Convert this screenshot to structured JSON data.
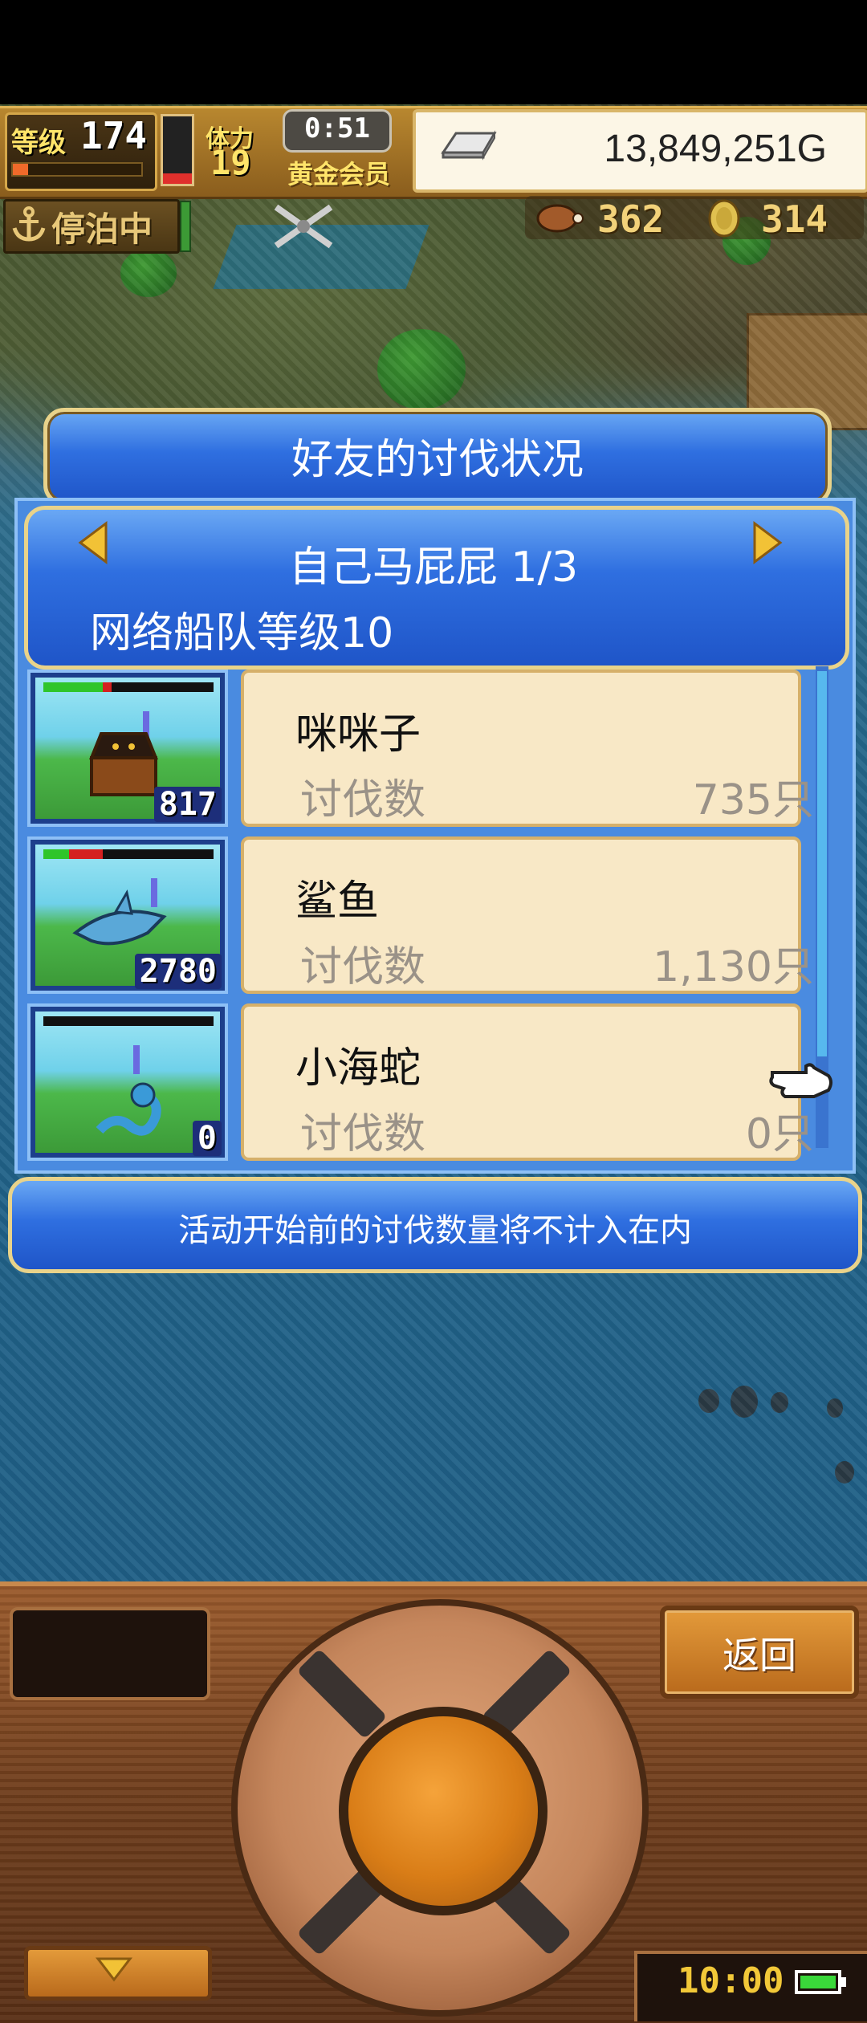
{
  "hud": {
    "level_label": "等级",
    "level": "174",
    "level_progress": 0.12,
    "stamina_label": "体力",
    "stamina": "19",
    "stamina_gauge": 0.15,
    "timer": "0:51",
    "member_label": "黄金会员",
    "gold": "13,849,251G",
    "dock_status": "停泊中",
    "food": "362",
    "wood": "314"
  },
  "dialog": {
    "title": "好友的讨伐状况",
    "friend_name": "自己马屁屁 1/3",
    "fleet_level": "网络船队等级10",
    "monsters": [
      {
        "name": "咪咪子",
        "kill_label": "讨伐数",
        "kills": "735只",
        "count": "817",
        "hp_green": 0.35,
        "hp_red": 0.05
      },
      {
        "name": "鲨鱼",
        "kill_label": "讨伐数",
        "kills": "1,130只",
        "count": "2780",
        "hp_green": 0.15,
        "hp_red": 0.2
      },
      {
        "name": "小海蛇",
        "kill_label": "讨伐数",
        "kills": "0只",
        "count": "0",
        "hp_green": 0,
        "hp_red": 0
      }
    ],
    "notice": "活动开始前的讨伐数量将不计入在内"
  },
  "controls": {
    "back_label": "返回",
    "clock": "10:00"
  },
  "colors": {
    "panel_blue": "#2f6fe0",
    "card_bg": "#f8e8c6",
    "gold_border": "#e9d38a",
    "hp_green": "#2fc52a",
    "hp_red": "#d42020"
  }
}
